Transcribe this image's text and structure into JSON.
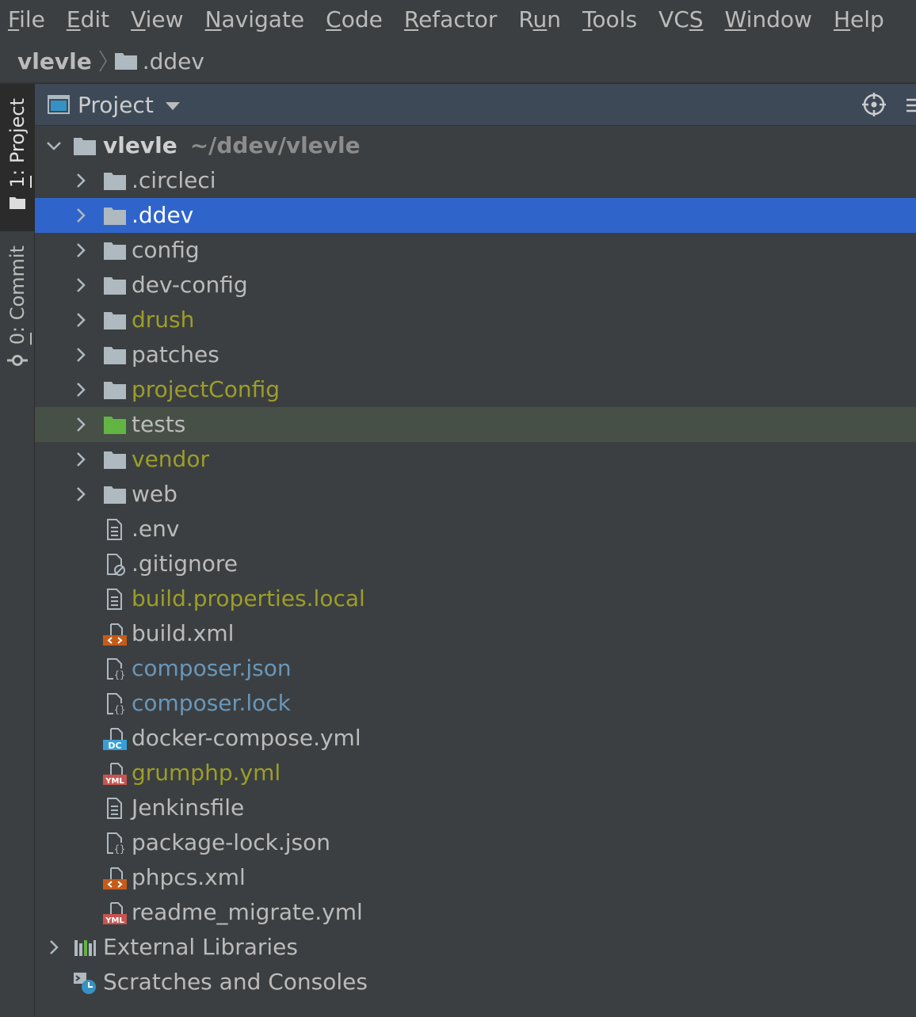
{
  "menu": [
    {
      "mnemonic": "F",
      "rest": "ile"
    },
    {
      "mnemonic": "E",
      "rest": "dit"
    },
    {
      "mnemonic": "V",
      "rest": "iew"
    },
    {
      "mnemonic": "N",
      "rest": "avigate"
    },
    {
      "mnemonic": "C",
      "rest": "ode"
    },
    {
      "mnemonic": "R",
      "rest": "efactor"
    },
    {
      "prefix": "R",
      "mnemonic": "u",
      "rest": "n"
    },
    {
      "mnemonic": "T",
      "rest": "ools"
    },
    {
      "prefix": "VC",
      "mnemonic": "S",
      "rest": ""
    },
    {
      "mnemonic": "W",
      "rest": "indow"
    },
    {
      "mnemonic": "H",
      "rest": "elp"
    }
  ],
  "breadcrumb": {
    "root": "vlevle",
    "current": ".ddev",
    "current_icon": "folder-icon"
  },
  "toolstrip": {
    "project_tab": {
      "mnemonic": "1",
      "label": ": Project",
      "icon": "folder-icon"
    },
    "commit_tab": {
      "mnemonic": "0",
      "label": ": Commit",
      "icon": "commit-icon"
    }
  },
  "panel": {
    "title": "Project",
    "title_icon": "project-window-icon",
    "dropdown_icon": "chevron-down-icon",
    "locate_icon": "crosshair-icon",
    "options_icon": "collapse-icon"
  },
  "tree": {
    "root": {
      "name": "vlevle",
      "path": "~/ddev/vlevle",
      "expanded": true,
      "icon": "folder-icon"
    },
    "children": [
      {
        "name": ".circleci",
        "kind": "folder",
        "icon": "folder-icon",
        "status": "normal"
      },
      {
        "name": ".ddev",
        "kind": "folder",
        "icon": "folder-icon",
        "status": "normal",
        "selected": true
      },
      {
        "name": "config",
        "kind": "folder",
        "icon": "folder-icon",
        "status": "normal"
      },
      {
        "name": "dev-config",
        "kind": "folder",
        "icon": "folder-icon",
        "status": "normal"
      },
      {
        "name": "drush",
        "kind": "folder",
        "icon": "folder-icon",
        "status": "modified"
      },
      {
        "name": "patches",
        "kind": "folder",
        "icon": "folder-icon",
        "status": "normal"
      },
      {
        "name": "projectConfig",
        "kind": "folder",
        "icon": "folder-icon",
        "status": "modified"
      },
      {
        "name": "tests",
        "kind": "folder",
        "icon": "test-folder-icon",
        "status": "normal",
        "highlighted": true
      },
      {
        "name": "vendor",
        "kind": "folder",
        "icon": "folder-icon",
        "status": "modified"
      },
      {
        "name": "web",
        "kind": "folder",
        "icon": "folder-icon",
        "status": "normal"
      },
      {
        "name": ".env",
        "kind": "file",
        "icon": "text-file-icon",
        "status": "normal"
      },
      {
        "name": ".gitignore",
        "kind": "file",
        "icon": "ignore-file-icon",
        "status": "normal"
      },
      {
        "name": "build.properties.local",
        "kind": "file",
        "icon": "text-file-icon",
        "status": "modified"
      },
      {
        "name": "build.xml",
        "kind": "file",
        "icon": "xml-file-icon",
        "status": "normal"
      },
      {
        "name": "composer.json",
        "kind": "file",
        "icon": "json-file-icon",
        "status": "vcs"
      },
      {
        "name": "composer.lock",
        "kind": "file",
        "icon": "json-file-icon",
        "status": "vcs"
      },
      {
        "name": "docker-compose.yml",
        "kind": "file",
        "icon": "docker-compose-file-icon",
        "status": "normal"
      },
      {
        "name": "grumphp.yml",
        "kind": "file",
        "icon": "yaml-file-icon",
        "status": "modified"
      },
      {
        "name": "Jenkinsfile",
        "kind": "file",
        "icon": "text-file-icon",
        "status": "normal"
      },
      {
        "name": "package-lock.json",
        "kind": "file",
        "icon": "json-file-icon",
        "status": "normal"
      },
      {
        "name": "phpcs.xml",
        "kind": "file",
        "icon": "xml-file-icon",
        "status": "normal"
      },
      {
        "name": "readme_migrate.yml",
        "kind": "file",
        "icon": "yaml-file-icon",
        "status": "normal"
      }
    ],
    "external_libraries": {
      "name": "External Libraries",
      "icon": "library-icon"
    },
    "scratches": {
      "name": "Scratches and Consoles",
      "icon": "scratches-icon"
    }
  },
  "colors": {
    "background": "#3c3f41",
    "panel_header": "#3d4957",
    "selection": "#2f65ca",
    "test_folder_row": "#475047",
    "text": "#bbbbbb",
    "modified_text": "#9c9e29",
    "vcs_text": "#6897bb",
    "folder_icon": "#aeb9c0",
    "test_folder_icon": "#62b543",
    "xml_badge": "#c65b19",
    "yaml_badge": "#c75450",
    "docker_badge": "#389fd6"
  }
}
